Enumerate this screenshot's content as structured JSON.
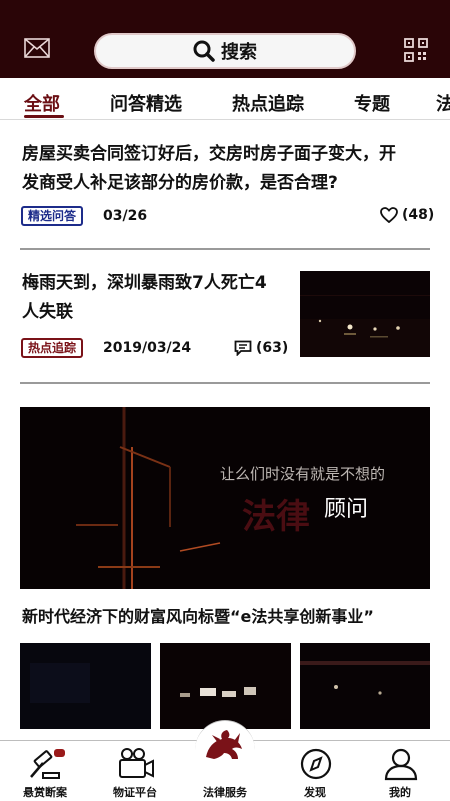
{
  "header": {
    "search_label": "搜索"
  },
  "tabs": [
    "全部",
    "问答精选",
    "热点追踪",
    "专题",
    "法"
  ],
  "article1": {
    "title_line1": "房屋买卖合同签订好后，交房时房子面子变大，开",
    "title_line2": "发商受人补足该部分的房价款，是否合理?",
    "tag": "精选问答",
    "date": "03/26",
    "likes": "(48)"
  },
  "article2": {
    "title_line1": "梅雨天到，深圳暴雨致7人死亡4",
    "title_line2": "人失联",
    "tag": "热点追踪",
    "date": "2019/03/24",
    "comments": "(63)"
  },
  "banner": {
    "text_top": "让么们时没有就是不想的",
    "text_brand": "法律",
    "text_sub": "顾问"
  },
  "article3": {
    "title": "新时代经济下的财富风向标暨“e法共享创新事业”"
  },
  "bottom_nav": [
    {
      "label": "悬赏断案",
      "icon": "gavel-icon"
    },
    {
      "label": "物证平台",
      "icon": "camera-icon"
    },
    {
      "label": "法律服务",
      "icon": "dragon-logo-icon"
    },
    {
      "label": "发现",
      "icon": "compass-icon"
    },
    {
      "label": "我的",
      "icon": "user-icon"
    }
  ],
  "colors": {
    "header_bg": "#2a0507",
    "accent": "#6b0f14",
    "tag_blue": "#1d2c8a"
  }
}
